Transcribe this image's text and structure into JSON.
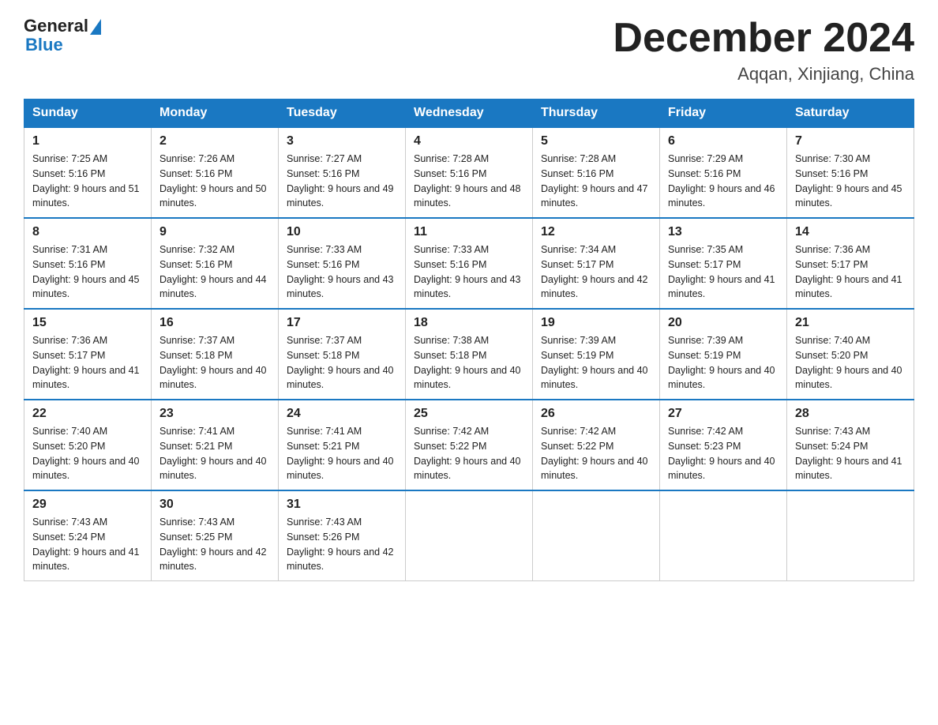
{
  "header": {
    "logo_general": "General",
    "logo_blue": "Blue",
    "month_title": "December 2024",
    "location": "Aqqan, Xinjiang, China"
  },
  "days_of_week": [
    "Sunday",
    "Monday",
    "Tuesday",
    "Wednesday",
    "Thursday",
    "Friday",
    "Saturday"
  ],
  "weeks": [
    [
      {
        "day": "1",
        "sunrise": "7:25 AM",
        "sunset": "5:16 PM",
        "daylight": "9 hours and 51 minutes."
      },
      {
        "day": "2",
        "sunrise": "7:26 AM",
        "sunset": "5:16 PM",
        "daylight": "9 hours and 50 minutes."
      },
      {
        "day": "3",
        "sunrise": "7:27 AM",
        "sunset": "5:16 PM",
        "daylight": "9 hours and 49 minutes."
      },
      {
        "day": "4",
        "sunrise": "7:28 AM",
        "sunset": "5:16 PM",
        "daylight": "9 hours and 48 minutes."
      },
      {
        "day": "5",
        "sunrise": "7:28 AM",
        "sunset": "5:16 PM",
        "daylight": "9 hours and 47 minutes."
      },
      {
        "day": "6",
        "sunrise": "7:29 AM",
        "sunset": "5:16 PM",
        "daylight": "9 hours and 46 minutes."
      },
      {
        "day": "7",
        "sunrise": "7:30 AM",
        "sunset": "5:16 PM",
        "daylight": "9 hours and 45 minutes."
      }
    ],
    [
      {
        "day": "8",
        "sunrise": "7:31 AM",
        "sunset": "5:16 PM",
        "daylight": "9 hours and 45 minutes."
      },
      {
        "day": "9",
        "sunrise": "7:32 AM",
        "sunset": "5:16 PM",
        "daylight": "9 hours and 44 minutes."
      },
      {
        "day": "10",
        "sunrise": "7:33 AM",
        "sunset": "5:16 PM",
        "daylight": "9 hours and 43 minutes."
      },
      {
        "day": "11",
        "sunrise": "7:33 AM",
        "sunset": "5:16 PM",
        "daylight": "9 hours and 43 minutes."
      },
      {
        "day": "12",
        "sunrise": "7:34 AM",
        "sunset": "5:17 PM",
        "daylight": "9 hours and 42 minutes."
      },
      {
        "day": "13",
        "sunrise": "7:35 AM",
        "sunset": "5:17 PM",
        "daylight": "9 hours and 41 minutes."
      },
      {
        "day": "14",
        "sunrise": "7:36 AM",
        "sunset": "5:17 PM",
        "daylight": "9 hours and 41 minutes."
      }
    ],
    [
      {
        "day": "15",
        "sunrise": "7:36 AM",
        "sunset": "5:17 PM",
        "daylight": "9 hours and 41 minutes."
      },
      {
        "day": "16",
        "sunrise": "7:37 AM",
        "sunset": "5:18 PM",
        "daylight": "9 hours and 40 minutes."
      },
      {
        "day": "17",
        "sunrise": "7:37 AM",
        "sunset": "5:18 PM",
        "daylight": "9 hours and 40 minutes."
      },
      {
        "day": "18",
        "sunrise": "7:38 AM",
        "sunset": "5:18 PM",
        "daylight": "9 hours and 40 minutes."
      },
      {
        "day": "19",
        "sunrise": "7:39 AM",
        "sunset": "5:19 PM",
        "daylight": "9 hours and 40 minutes."
      },
      {
        "day": "20",
        "sunrise": "7:39 AM",
        "sunset": "5:19 PM",
        "daylight": "9 hours and 40 minutes."
      },
      {
        "day": "21",
        "sunrise": "7:40 AM",
        "sunset": "5:20 PM",
        "daylight": "9 hours and 40 minutes."
      }
    ],
    [
      {
        "day": "22",
        "sunrise": "7:40 AM",
        "sunset": "5:20 PM",
        "daylight": "9 hours and 40 minutes."
      },
      {
        "day": "23",
        "sunrise": "7:41 AM",
        "sunset": "5:21 PM",
        "daylight": "9 hours and 40 minutes."
      },
      {
        "day": "24",
        "sunrise": "7:41 AM",
        "sunset": "5:21 PM",
        "daylight": "9 hours and 40 minutes."
      },
      {
        "day": "25",
        "sunrise": "7:42 AM",
        "sunset": "5:22 PM",
        "daylight": "9 hours and 40 minutes."
      },
      {
        "day": "26",
        "sunrise": "7:42 AM",
        "sunset": "5:22 PM",
        "daylight": "9 hours and 40 minutes."
      },
      {
        "day": "27",
        "sunrise": "7:42 AM",
        "sunset": "5:23 PM",
        "daylight": "9 hours and 40 minutes."
      },
      {
        "day": "28",
        "sunrise": "7:43 AM",
        "sunset": "5:24 PM",
        "daylight": "9 hours and 41 minutes."
      }
    ],
    [
      {
        "day": "29",
        "sunrise": "7:43 AM",
        "sunset": "5:24 PM",
        "daylight": "9 hours and 41 minutes."
      },
      {
        "day": "30",
        "sunrise": "7:43 AM",
        "sunset": "5:25 PM",
        "daylight": "9 hours and 42 minutes."
      },
      {
        "day": "31",
        "sunrise": "7:43 AM",
        "sunset": "5:26 PM",
        "daylight": "9 hours and 42 minutes."
      },
      null,
      null,
      null,
      null
    ]
  ]
}
